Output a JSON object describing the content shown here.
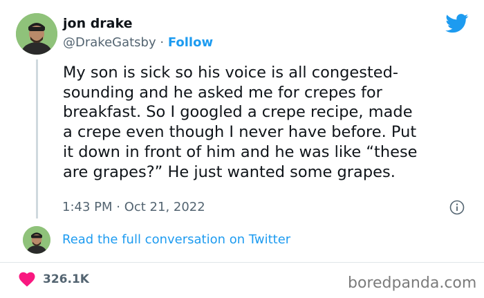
{
  "author": {
    "name": "jon drake",
    "handle": "@DrakeGatsby",
    "separator": " · ",
    "follow_label": "Follow"
  },
  "tweet": {
    "lines": [
      "My son is sick so his voice is all congested-",
      "sounding and he asked me for crepes for",
      "breakfast. So I googled a crepe recipe, made",
      "a crepe even though I never have before. Put",
      "it down in front of him and he was like “these",
      "are grapes?” He just wanted some grapes."
    ],
    "timestamp": "1:43 PM · Oct 21, 2022"
  },
  "conversation_link": "Read the full conversation on Twitter",
  "engagement": {
    "likes": "326.1K"
  },
  "watermark": "boredpanda.com",
  "icons": {
    "brand": "twitter-bird-icon",
    "info": "info-icon",
    "like": "heart-icon"
  },
  "colors": {
    "accent": "#1d9bf0",
    "text": "#0f1419",
    "muted": "#536471",
    "heart": "#f91880",
    "thread_line": "#cfd9de"
  }
}
